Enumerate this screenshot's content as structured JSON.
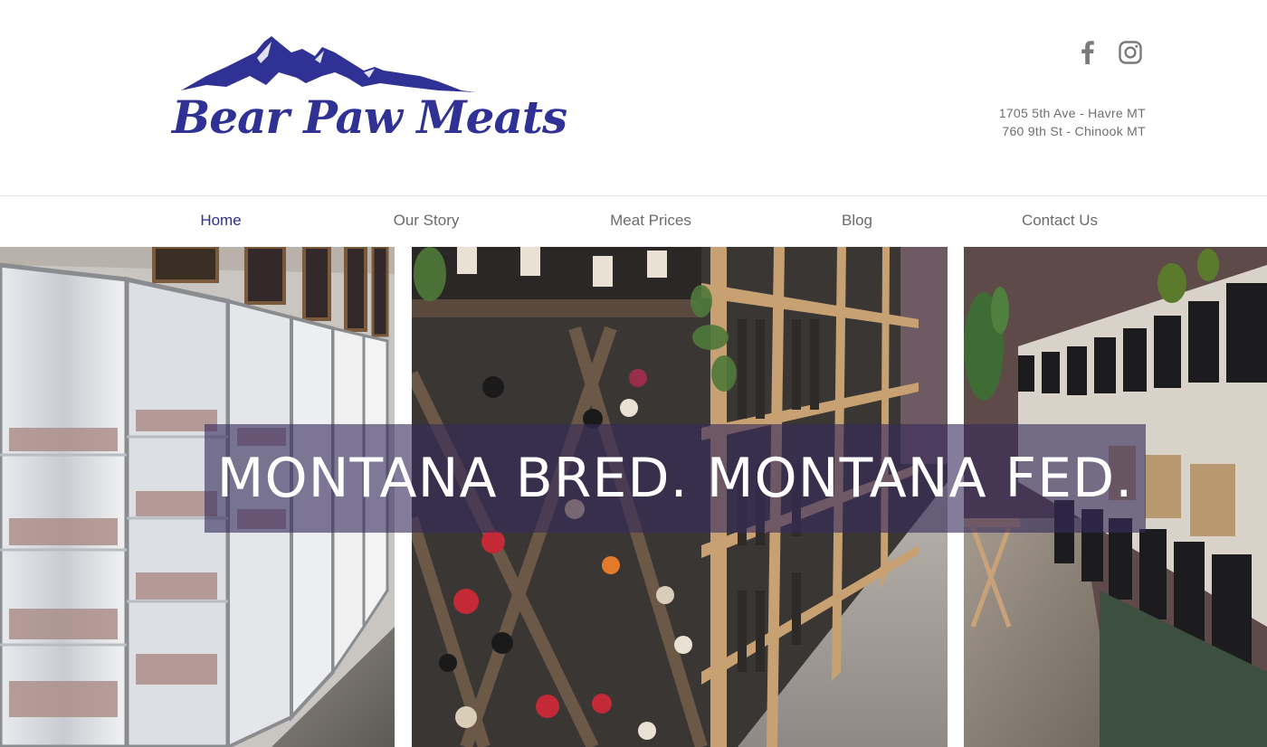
{
  "brand": {
    "name": "Bear Paw Meats",
    "color": "#2f3194"
  },
  "social": {
    "facebook_icon": "facebook-icon",
    "instagram_icon": "instagram-icon"
  },
  "address": {
    "line1": "1705 5th Ave - Havre MT",
    "line2": "760 9th St - Chinook MT"
  },
  "nav": {
    "items": [
      {
        "label": "Home",
        "active": true
      },
      {
        "label": "Our Story",
        "active": false
      },
      {
        "label": "Meat Prices",
        "active": false
      },
      {
        "label": "Blog",
        "active": false
      },
      {
        "label": "Contact Us",
        "active": false
      }
    ],
    "active_color": "#2f3194",
    "inactive_color": "#6b6b6b"
  },
  "hero": {
    "headline": "MONTANA BRED. MONTANA FED.",
    "banner_color": "#372c5c",
    "panels": [
      "meat-coolers-photo",
      "wine-rack-photo",
      "bulk-bins-photo"
    ]
  }
}
